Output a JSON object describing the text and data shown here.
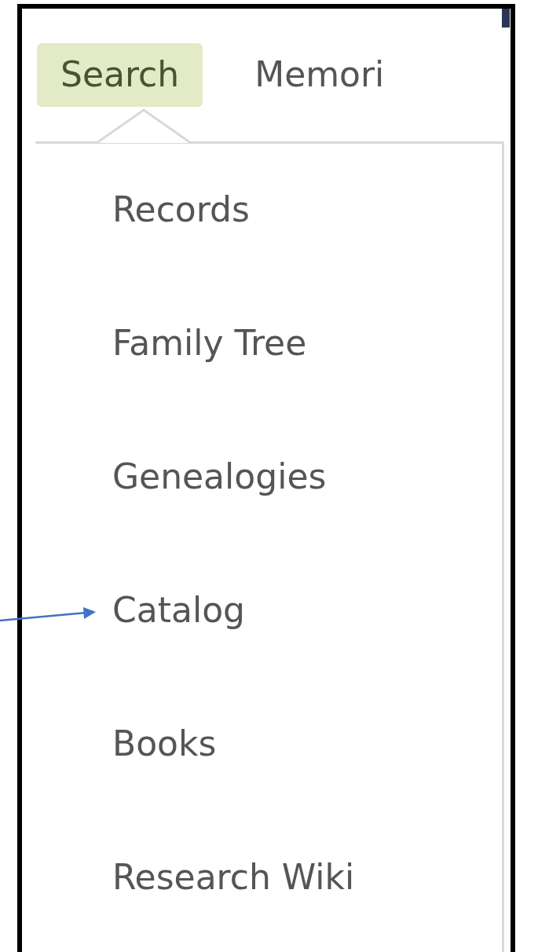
{
  "tabs": [
    {
      "label": "Search",
      "selected": true
    },
    {
      "label": "Memori",
      "selected": false
    }
  ],
  "menu": {
    "items": [
      {
        "label": "Records"
      },
      {
        "label": "Family Tree"
      },
      {
        "label": "Genealogies"
      },
      {
        "label": "Catalog"
      },
      {
        "label": "Books"
      },
      {
        "label": "Research Wiki"
      }
    ]
  }
}
